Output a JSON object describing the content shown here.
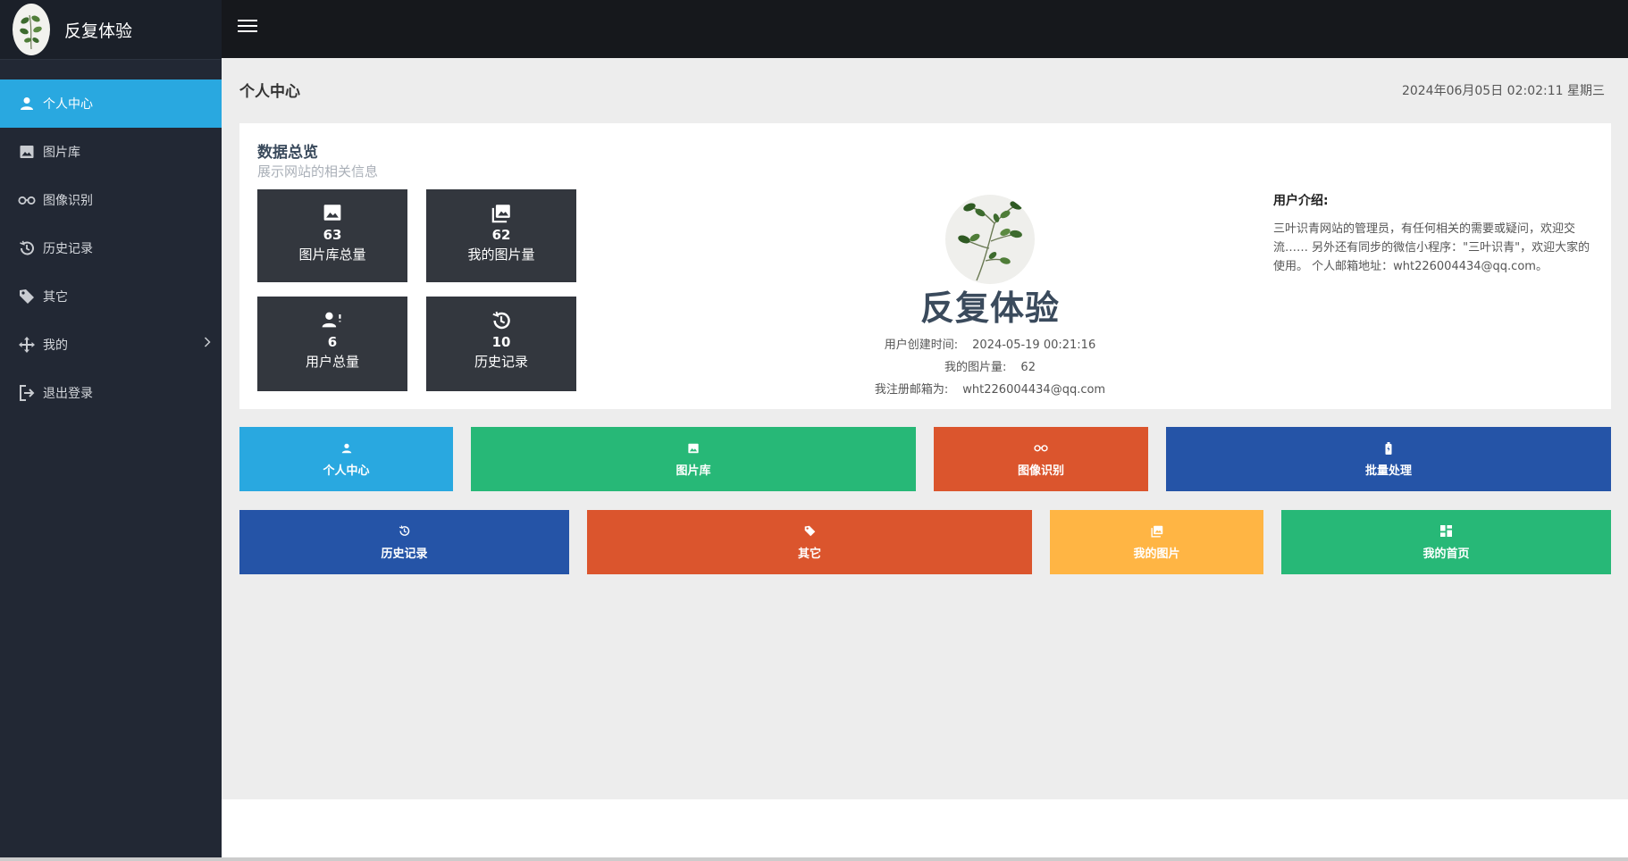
{
  "brand": {
    "name": "反复体验"
  },
  "sidebar": {
    "items": [
      {
        "label": "个人中心",
        "icon": "user-icon",
        "active": true
      },
      {
        "label": "图片库",
        "icon": "image-icon"
      },
      {
        "label": "图像识别",
        "icon": "glasses-icon"
      },
      {
        "label": "历史记录",
        "icon": "history-icon"
      },
      {
        "label": "其它",
        "icon": "tag-icon"
      },
      {
        "label": "我的",
        "icon": "move-icon",
        "has_submenu": true
      },
      {
        "label": "退出登录",
        "icon": "logout-icon"
      }
    ]
  },
  "header": {
    "menu_icon": "hamburger-icon"
  },
  "page": {
    "title": "个人中心",
    "datetime": "2024年06月05日  02:02:11  星期三"
  },
  "overview": {
    "title": "数据总览",
    "subtitle": "展示网站的相关信息",
    "stats": [
      {
        "value": "63",
        "label": "图片库总量",
        "icon": "image-icon"
      },
      {
        "value": "62",
        "label": "我的图片量",
        "icon": "images-icon"
      },
      {
        "value": "6",
        "label": "用户总量",
        "icon": "user-plus-icon"
      },
      {
        "value": "10",
        "label": "历史记录",
        "icon": "history-icon"
      }
    ],
    "profile": {
      "name": "反复体验",
      "created_label": "用户创建时间:",
      "created_value": "2024-05-19 00:21:16",
      "images_label": "我的图片量:",
      "images_value": "62",
      "email_label": "我注册邮箱为:",
      "email_value": "wht226004434@qq.com"
    },
    "intro": {
      "title": "用户介绍:",
      "text": "三叶识青网站的管理员，有任何相关的需要或疑问，欢迎交流…… 另外还有同步的微信小程序：\"三叶识青\"，欢迎大家的使用。 个人邮箱地址：wht226004434@qq.com。"
    }
  },
  "quick_buttons": [
    {
      "label": "个人中心",
      "icon": "user-icon",
      "color": "#29a8e0"
    },
    {
      "label": "图片库",
      "icon": "image-icon",
      "color": "#27b877"
    },
    {
      "label": "图像识别",
      "icon": "glasses-icon",
      "color": "#db552d"
    },
    {
      "label": "批量处理",
      "icon": "battery-icon",
      "color": "#2554a7"
    },
    {
      "label": "历史记录",
      "icon": "history-icon",
      "color": "#2554a7"
    },
    {
      "label": "其它",
      "icon": "tag-icon",
      "color": "#db552d"
    },
    {
      "label": "我的图片",
      "icon": "images-icon",
      "color": "#ffb544"
    },
    {
      "label": "我的首页",
      "icon": "dashboard-icon",
      "color": "#27b877"
    }
  ],
  "colors": {
    "sidebar_bg": "#222834",
    "active": "#29a8e0",
    "topbar_bg": "#16181c",
    "stat_bg": "#33373e"
  }
}
